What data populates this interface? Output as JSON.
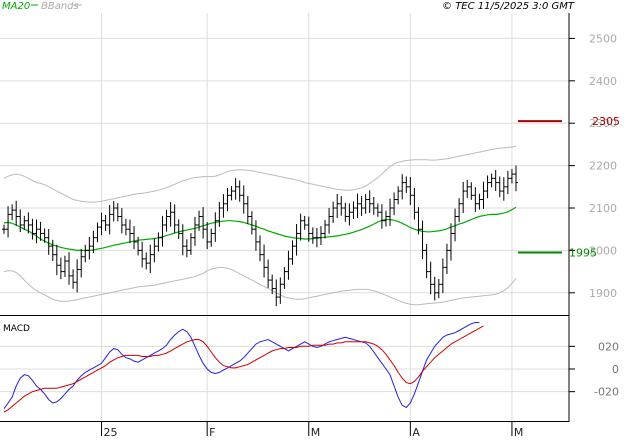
{
  "legend": {
    "ma_label": "MA20",
    "bb_label": "BBands"
  },
  "copyright": "© TEC 11/5/2025 3:0 GMT",
  "macd_label": "MACD",
  "colors": {
    "price": "#000000",
    "ma": "#00aa00",
    "bbands": "#bbbbbb",
    "macd": "#2222dd",
    "signal": "#cc0000",
    "resistance": "#aa0000",
    "support": "#008800",
    "grid": "#dddddd"
  },
  "chart_data": {
    "type": "ohlc",
    "price_ylim": [
      1850,
      2560
    ],
    "price_ticks": [
      1900,
      2000,
      2100,
      2200,
      2300,
      2400,
      2500
    ],
    "macd_ylim": [
      -45,
      45
    ],
    "macd_ticks": [
      20,
      0,
      -20
    ],
    "macd_tick_labels": [
      "020",
      "0",
      "-020"
    ],
    "x_labels": [
      {
        "label": "25",
        "index": 24
      },
      {
        "label": "F",
        "index": 50
      },
      {
        "label": "M",
        "index": 75
      },
      {
        "label": "A",
        "index": 100
      },
      {
        "label": "M",
        "index": 125
      }
    ],
    "resistance": {
      "value": 2305,
      "label": "2305"
    },
    "support": {
      "value": 1995,
      "label": "1995"
    },
    "closes": [
      2050,
      2085,
      2095,
      2080,
      2060,
      2070,
      2060,
      2040,
      2050,
      2040,
      2030,
      2010,
      1990,
      1965,
      1950,
      1975,
      1940,
      1925,
      1955,
      1985,
      2000,
      2010,
      2030,
      2055,
      2070,
      2060,
      2085,
      2100,
      2080,
      2060,
      2050,
      2040,
      2020,
      2000,
      1980,
      1970,
      1990,
      2010,
      2030,
      2060,
      2080,
      2090,
      2060,
      2040,
      2010,
      2000,
      2030,
      2060,
      2080,
      2050,
      2020,
      2040,
      2070,
      2100,
      2110,
      2130,
      2140,
      2150,
      2130,
      2110,
      2080,
      2050,
      2020,
      1990,
      1960,
      1930,
      1910,
      1890,
      1920,
      1950,
      1980,
      2010,
      2040,
      2070,
      2060,
      2040,
      2030,
      2030,
      2040,
      2060,
      2080,
      2100,
      2110,
      2100,
      2080,
      2090,
      2100,
      2110,
      2100,
      2120,
      2110,
      2100,
      2090,
      2070,
      2080,
      2100,
      2120,
      2140,
      2160,
      2150,
      2130,
      2090,
      2050,
      2000,
      1950,
      1920,
      1900,
      1920,
      1960,
      2000,
      2040,
      2080,
      2110,
      2140,
      2150,
      2130,
      2110,
      2120,
      2140,
      2160,
      2170,
      2160,
      2140,
      2150,
      2170,
      2180,
      2160
    ],
    "ma20": [
      2065,
      2066,
      2064,
      2060,
      2055,
      2050,
      2046,
      2040,
      2034,
      2027,
      2022,
      2017,
      2013,
      2010,
      2007,
      2005,
      2003,
      2002,
      2000,
      2000,
      2000,
      2000,
      2001,
      2003,
      2005,
      2007,
      2010,
      2012,
      2014,
      2016,
      2018,
      2020,
      2022,
      2024,
      2025,
      2026,
      2027,
      2028,
      2030,
      2032,
      2035,
      2038,
      2041,
      2044,
      2046,
      2048,
      2050,
      2052,
      2055,
      2058,
      2061,
      2064,
      2066,
      2068,
      2069,
      2070,
      2070,
      2069,
      2068,
      2066,
      2063,
      2060,
      2057,
      2053,
      2050,
      2046,
      2043,
      2040,
      2037,
      2034,
      2032,
      2030,
      2029,
      2028,
      2027,
      2027,
      2028,
      2029,
      2030,
      2031,
      2032,
      2033,
      2034,
      2036,
      2038,
      2040,
      2043,
      2046,
      2049,
      2053,
      2057,
      2062,
      2067,
      2071,
      2073,
      2073,
      2071,
      2068,
      2064,
      2059,
      2054,
      2050,
      2047,
      2045,
      2044,
      2044,
      2045,
      2046,
      2048,
      2051,
      2055,
      2058,
      2062,
      2065,
      2069,
      2073,
      2077,
      2080,
      2082,
      2084,
      2085,
      2085,
      2086,
      2088,
      2091,
      2096,
      2102
    ],
    "bb_upper": [
      2170,
      2175,
      2178,
      2180,
      2178,
      2175,
      2170,
      2165,
      2160,
      2158,
      2155,
      2150,
      2145,
      2140,
      2135,
      2130,
      2125,
      2120,
      2118,
      2116,
      2115,
      2114,
      2114,
      2115,
      2116,
      2118,
      2120,
      2122,
      2124,
      2126,
      2128,
      2130,
      2132,
      2134,
      2135,
      2136,
      2138,
      2140,
      2142,
      2145,
      2148,
      2152,
      2156,
      2160,
      2164,
      2167,
      2170,
      2172,
      2173,
      2174,
      2174,
      2174,
      2175,
      2178,
      2182,
      2186,
      2188,
      2190,
      2190,
      2190,
      2189,
      2188,
      2186,
      2184,
      2182,
      2180,
      2178,
      2176,
      2174,
      2172,
      2170,
      2168,
      2166,
      2164,
      2160,
      2158,
      2156,
      2154,
      2152,
      2150,
      2148,
      2146,
      2144,
      2143,
      2142,
      2142,
      2143,
      2145,
      2148,
      2152,
      2158,
      2165,
      2172,
      2180,
      2190,
      2198,
      2204,
      2208,
      2210,
      2212,
      2213,
      2214,
      2214,
      2214,
      2214,
      2213,
      2213,
      2214,
      2215,
      2216,
      2218,
      2220,
      2222,
      2224,
      2226,
      2228,
      2230,
      2232,
      2234,
      2236,
      2238,
      2240,
      2241,
      2242,
      2243,
      2244,
      2246
    ],
    "bb_lower": [
      1950,
      1952,
      1952,
      1948,
      1940,
      1930,
      1920,
      1912,
      1905,
      1900,
      1895,
      1890,
      1885,
      1882,
      1880,
      1880,
      1880,
      1882,
      1884,
      1886,
      1888,
      1890,
      1892,
      1894,
      1896,
      1898,
      1900,
      1902,
      1904,
      1906,
      1908,
      1910,
      1912,
      1914,
      1915,
      1916,
      1917,
      1918,
      1920,
      1922,
      1924,
      1926,
      1928,
      1930,
      1932,
      1934,
      1936,
      1938,
      1942,
      1946,
      1952,
      1956,
      1958,
      1960,
      1960,
      1958,
      1955,
      1950,
      1945,
      1940,
      1935,
      1930,
      1925,
      1920,
      1915,
      1910,
      1905,
      1900,
      1895,
      1890,
      1888,
      1886,
      1885,
      1885,
      1886,
      1888,
      1890,
      1892,
      1894,
      1896,
      1898,
      1900,
      1902,
      1904,
      1905,
      1906,
      1907,
      1908,
      1908,
      1908,
      1907,
      1905,
      1902,
      1898,
      1894,
      1890,
      1886,
      1882,
      1878,
      1875,
      1873,
      1872,
      1872,
      1873,
      1874,
      1875,
      1876,
      1877,
      1878,
      1880,
      1882,
      1884,
      1886,
      1888,
      1889,
      1890,
      1891,
      1892,
      1893,
      1894,
      1895,
      1897,
      1900,
      1905,
      1912,
      1922,
      1935
    ],
    "macd": [
      -35,
      -30,
      -25,
      -15,
      -8,
      -5,
      -6,
      -10,
      -15,
      -18,
      -22,
      -27,
      -30,
      -29,
      -26,
      -22,
      -18,
      -15,
      -10,
      -6,
      -3,
      -1,
      1,
      3,
      5,
      10,
      15,
      18,
      17,
      13,
      10,
      9,
      7,
      6,
      8,
      10,
      12,
      14,
      16,
      18,
      21,
      26,
      30,
      33,
      35,
      33,
      28,
      20,
      12,
      5,
      0,
      -3,
      -4,
      -3,
      -1,
      1,
      3,
      5,
      7,
      10,
      14,
      18,
      22,
      24,
      25,
      26,
      24,
      22,
      20,
      18,
      16,
      18,
      20,
      22,
      24,
      22,
      20,
      19,
      20,
      22,
      24,
      25,
      26,
      27,
      28,
      27,
      26,
      25,
      24,
      23,
      20,
      15,
      10,
      5,
      0,
      -5,
      -15,
      -25,
      -32,
      -34,
      -30,
      -22,
      -12,
      -2,
      8,
      14,
      20,
      24,
      28,
      30,
      31,
      32,
      34,
      36,
      38,
      40,
      41,
      41
    ],
    "signal": [
      -38,
      -36,
      -33,
      -30,
      -27,
      -24,
      -22,
      -20,
      -19,
      -18,
      -17,
      -17,
      -17,
      -17,
      -16,
      -15,
      -14,
      -13,
      -11,
      -9,
      -7,
      -5,
      -3,
      -1,
      1,
      3,
      6,
      8,
      10,
      11,
      12,
      12,
      12,
      12,
      11,
      11,
      11,
      12,
      12,
      13,
      14,
      16,
      18,
      20,
      22,
      24,
      25,
      26,
      26,
      24,
      20,
      15,
      10,
      6,
      3,
      2,
      1,
      1,
      2,
      3,
      4,
      6,
      8,
      10,
      12,
      14,
      16,
      17,
      18,
      18,
      19,
      19,
      19,
      20,
      20,
      20,
      21,
      21,
      21,
      21,
      22,
      22,
      23,
      23,
      24,
      24,
      24,
      24,
      24,
      24,
      23,
      22,
      20,
      17,
      13,
      8,
      3,
      -3,
      -8,
      -12,
      -13,
      -11,
      -7,
      -2,
      2,
      6,
      10,
      13,
      16,
      19,
      22,
      24,
      26,
      28,
      30,
      32,
      34,
      36,
      38
    ]
  }
}
